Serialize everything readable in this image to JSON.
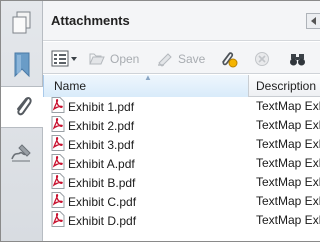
{
  "panel": {
    "title": "Attachments"
  },
  "toolbar": {
    "open_label": "Open",
    "save_label": "Save"
  },
  "table": {
    "columns": [
      "Name",
      "Description"
    ],
    "rows": [
      {
        "name": "Exhibit 1.pdf",
        "description": "TextMap Exhibit"
      },
      {
        "name": "Exhibit 2.pdf",
        "description": "TextMap Exhibit"
      },
      {
        "name": "Exhibit 3.pdf",
        "description": "TextMap Exhibit"
      },
      {
        "name": "Exhibit A.pdf",
        "description": "TextMap Exhibit"
      },
      {
        "name": "Exhibit B.pdf",
        "description": "TextMap Exhibit"
      },
      {
        "name": "Exhibit C.pdf",
        "description": "TextMap Exhibit"
      },
      {
        "name": "Exhibit D.pdf",
        "description": "TextMap Exhibit"
      }
    ]
  },
  "icons": {
    "rail": [
      "pages-icon",
      "bookmark-icon",
      "paperclip-icon",
      "signature-icon"
    ],
    "file": "pdf-file-icon"
  },
  "colors": {
    "header_active": "#d9ebfa",
    "pdf_red": "#c8102e",
    "bookmark_blue": "#6a9cc7"
  }
}
